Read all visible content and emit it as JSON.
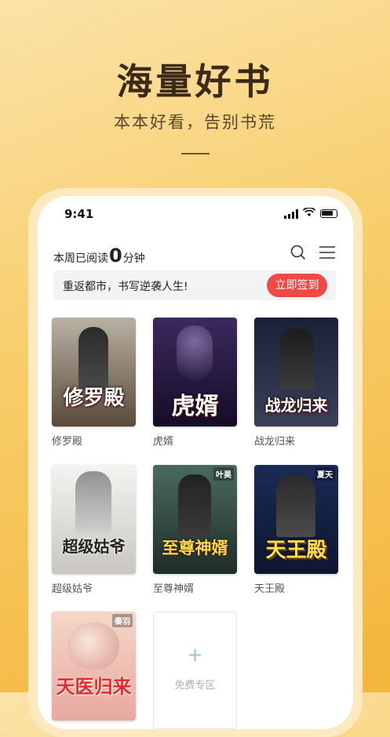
{
  "hero": {
    "title": "海量好书",
    "subtitle": "本本好看，告别书荒"
  },
  "status_bar": {
    "time": "9:41"
  },
  "header": {
    "weekly_prefix": "本周已阅读",
    "weekly_minutes": "0",
    "weekly_suffix": "分钟",
    "search_icon": "search-icon",
    "menu_icon": "menu-icon"
  },
  "banner": {
    "text": "重返都市，书写逆袭人生!",
    "button": "立即签到"
  },
  "books": [
    {
      "name": "修罗殿",
      "cover_title": "修罗殿",
      "tag": "",
      "color_top": "#b9b2a3",
      "color_bottom": "#5a4a3a"
    },
    {
      "name": "虎婿",
      "cover_title": "虎婿",
      "tag": "",
      "color_top": "#2e1f4a",
      "color_bottom": "#1a0f2c"
    },
    {
      "name": "战龙归来",
      "cover_title": "战龙归来",
      "tag": "",
      "color_top": "#1a2036",
      "color_bottom": "#3a4156"
    },
    {
      "name": "超级姑爷",
      "cover_title": "超级姑爷",
      "tag": "",
      "color_top": "#f1f0ee",
      "color_bottom": "#bcb8b3"
    },
    {
      "name": "至尊神婿",
      "cover_title": "至尊神婿",
      "tag": "叶昊",
      "color_top": "#4a6a5e",
      "color_bottom": "#1f2d2a"
    },
    {
      "name": "天王殿",
      "cover_title": "天王殿",
      "tag": "夏天",
      "color_top": "#1a2b55",
      "color_bottom": "#0e1630"
    },
    {
      "name": "",
      "cover_title": "天医归来",
      "tag": "秦羽",
      "color_top": "#f5d7c8",
      "color_bottom": "#e8a8a0"
    }
  ],
  "free_zone": {
    "plus": "+",
    "label": "免费专区"
  }
}
